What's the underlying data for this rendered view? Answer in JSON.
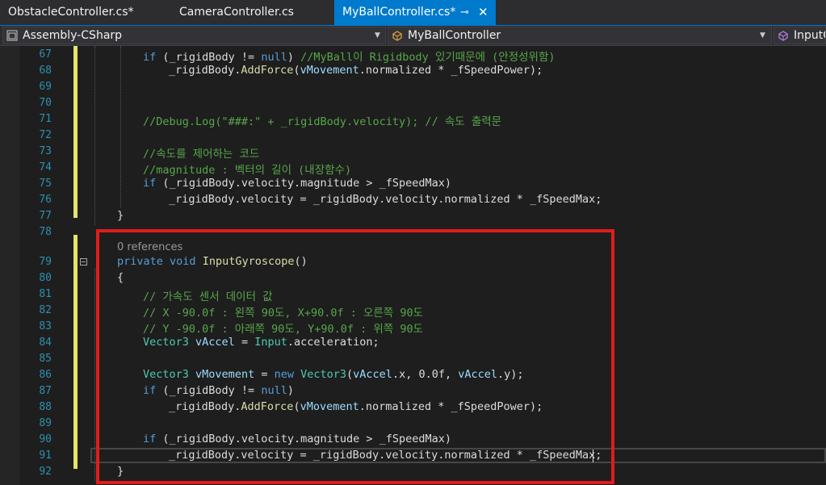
{
  "tabs": [
    {
      "label": "ObstacleController.cs*",
      "active": false
    },
    {
      "label": "CameraController.cs",
      "active": false
    },
    {
      "label": "MyBallController.cs*",
      "active": true,
      "pin_icon": "pin-icon",
      "close_icon": "close-icon"
    }
  ],
  "nav": {
    "project": "Assembly-CSharp",
    "class": "MyBallController",
    "member": "InputG"
  },
  "codelens": "0 references",
  "lines": [
    {
      "n": "67"
    },
    {
      "n": "68"
    },
    {
      "n": "69"
    },
    {
      "n": "70"
    },
    {
      "n": "71"
    },
    {
      "n": "72"
    },
    {
      "n": "73"
    },
    {
      "n": "74"
    },
    {
      "n": "75"
    },
    {
      "n": "76"
    },
    {
      "n": "77"
    },
    {
      "n": "78"
    },
    {
      "n": "79"
    },
    {
      "n": "80"
    },
    {
      "n": "81"
    },
    {
      "n": "82"
    },
    {
      "n": "83"
    },
    {
      "n": "84"
    },
    {
      "n": "85"
    },
    {
      "n": "86"
    },
    {
      "n": "87"
    },
    {
      "n": "88"
    },
    {
      "n": "89"
    },
    {
      "n": "90"
    },
    {
      "n": "91"
    },
    {
      "n": "92"
    }
  ],
  "code": {
    "l67_kw": "if",
    "l67_a": " (_rigidBody != ",
    "l67_null": "null",
    "l67_b": ") ",
    "l67_cm": "//MyBall이 Rigidbody 있기때문에 (안정성위함)",
    "l68_a": "_rigidBody.",
    "l68_fn": "AddForce",
    "l68_b": "(",
    "l68_pa": "vMovement",
    "l68_c": ".normalized * _fSpeedPower);",
    "l71_cm": "//Debug.Log(\"###:\" + _rigidBody.velocity); // 속도 출력문",
    "l73_cm": "//속도를 제어하는 코드",
    "l74_cm": "//magnitude : 벡터의 길이 (내장함수)",
    "l75_kw": "if",
    "l75_a": " (_rigidBody.velocity.magnitude > _fSpeedMax)",
    "l76_a": "_rigidBody.velocity = _rigidBody.velocity.normalized * _fSpeedMax;",
    "l77_a": "}",
    "l79_kw1": "private",
    "l79_kw2": "void",
    "l79_fn": "InputGyroscope",
    "l79_a": "()",
    "l80_a": "{",
    "l81_cm": "// 가속도 센서 데이터 값",
    "l82_cm": "// X -90.0f : 왼쪽 90도, X+90.0f : 오른쪽 90도",
    "l83_cm": "// Y -90.0f : 아래쪽 90도, Y+90.0f : 위쪽 90도",
    "l84_ty": "Vector3",
    "l84_pa": "vAccel",
    "l84_a": " = ",
    "l84_ty2": "Input",
    "l84_b": ".acceleration;",
    "l86_ty": "Vector3",
    "l86_pa": "vMovement",
    "l86_a": " = ",
    "l86_kw": "new",
    "l86_ty2": "Vector3",
    "l86_b": "(",
    "l86_pa2": "vAccel",
    "l86_c": ".x, 0.0f, ",
    "l86_pa3": "vAccel",
    "l86_d": ".y);",
    "l87_kw": "if",
    "l87_a": " (_rigidBody != ",
    "l87_null": "null",
    "l87_b": ")",
    "l88_a": "_rigidBody.",
    "l88_fn": "AddForce",
    "l88_b": "(",
    "l88_pa": "vMovement",
    "l88_c": ".normalized * _fSpeedPower);",
    "l90_kw": "if",
    "l90_a": " (_rigidBody.velocity.magnitude > _fSpeedMax)",
    "l91_a": "_rigidBody.velocity = _rigidBody.velocity.normalized * _fSpeedMax;",
    "l92_a": "}"
  },
  "colors": {
    "accent": "#007acc",
    "highlight_box": "#e01c1c",
    "keyword": "#569cd6",
    "comment": "#57a64a",
    "type": "#4ec9b0",
    "method": "#dcdcaa",
    "param": "#9cdcfe",
    "line_number": "#2b91af",
    "change_marker": "#e6e26a"
  }
}
